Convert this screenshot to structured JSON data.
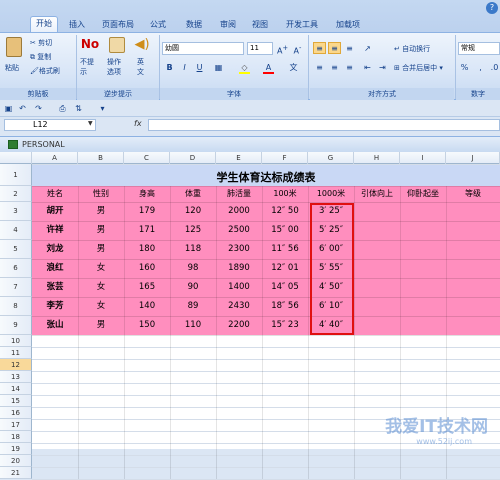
{
  "tabs": [
    "开始",
    "插入",
    "页面布局",
    "公式",
    "数据",
    "审阅",
    "视图",
    "开发工具",
    "加载项"
  ],
  "ribbon": {
    "clipboard": {
      "paste": "粘贴",
      "cut": "剪切",
      "copy": "复制",
      "format_painter": "格式刷",
      "label": "剪贴板"
    },
    "tips": {
      "no_prompt": "不提\n示",
      "op_options": "操作\n选项",
      "english": "英\n文",
      "label": "逆步提示"
    },
    "font": {
      "name": "幼圆",
      "size": "11",
      "label": "字体"
    },
    "align": {
      "wrap": "自动换行",
      "merge": "合并后居中",
      "label": "对齐方式"
    },
    "number": {
      "format": "常规",
      "label": "数字"
    }
  },
  "formula_bar": {
    "name_box": "L12",
    "fx": "fx",
    "content": ""
  },
  "workbook": {
    "title": "PERSONAL"
  },
  "columns": [
    "A",
    "B",
    "C",
    "D",
    "E",
    "F",
    "G",
    "H",
    "I",
    "J"
  ],
  "rows": [
    "1",
    "2",
    "3",
    "4",
    "5",
    "6",
    "7",
    "8",
    "9",
    "10",
    "11",
    "12",
    "13",
    "14",
    "15",
    "16",
    "17",
    "18",
    "19",
    "20",
    "21"
  ],
  "selected_row": "12",
  "sheet": {
    "title": "学生体育达标成绩表",
    "headers": [
      "姓名",
      "性别",
      "身高",
      "体重",
      "肺活量",
      "100米",
      "1000米",
      "引体向上",
      "仰卧起坐",
      "等级"
    ],
    "data": [
      [
        "胡开",
        "男",
        "179",
        "120",
        "2000",
        "12″ 50",
        "3′ 25″"
      ],
      [
        "许祥",
        "男",
        "171",
        "125",
        "2500",
        "15″ 00",
        "5′ 25″"
      ],
      [
        "刘龙",
        "男",
        "180",
        "118",
        "2300",
        "11″ 56",
        "6′ 00″"
      ],
      [
        "浪红",
        "女",
        "160",
        "98",
        "1890",
        "12″ 01",
        "5′ 55″"
      ],
      [
        "张芸",
        "女",
        "165",
        "90",
        "1400",
        "14″ 05",
        "4′ 50″"
      ],
      [
        "李芳",
        "女",
        "140",
        "89",
        "2430",
        "18″ 56",
        "6′ 10″"
      ],
      [
        "张山",
        "男",
        "150",
        "110",
        "2200",
        "15″ 23",
        "4′ 40″"
      ]
    ]
  },
  "watermark": {
    "text": "我爱IT技术网",
    "url": "www.52ij.com"
  },
  "colors": {
    "table_fill": "#ff8ebe",
    "highlight_border": "#e01010",
    "title_fill": "#c9d8f5"
  }
}
